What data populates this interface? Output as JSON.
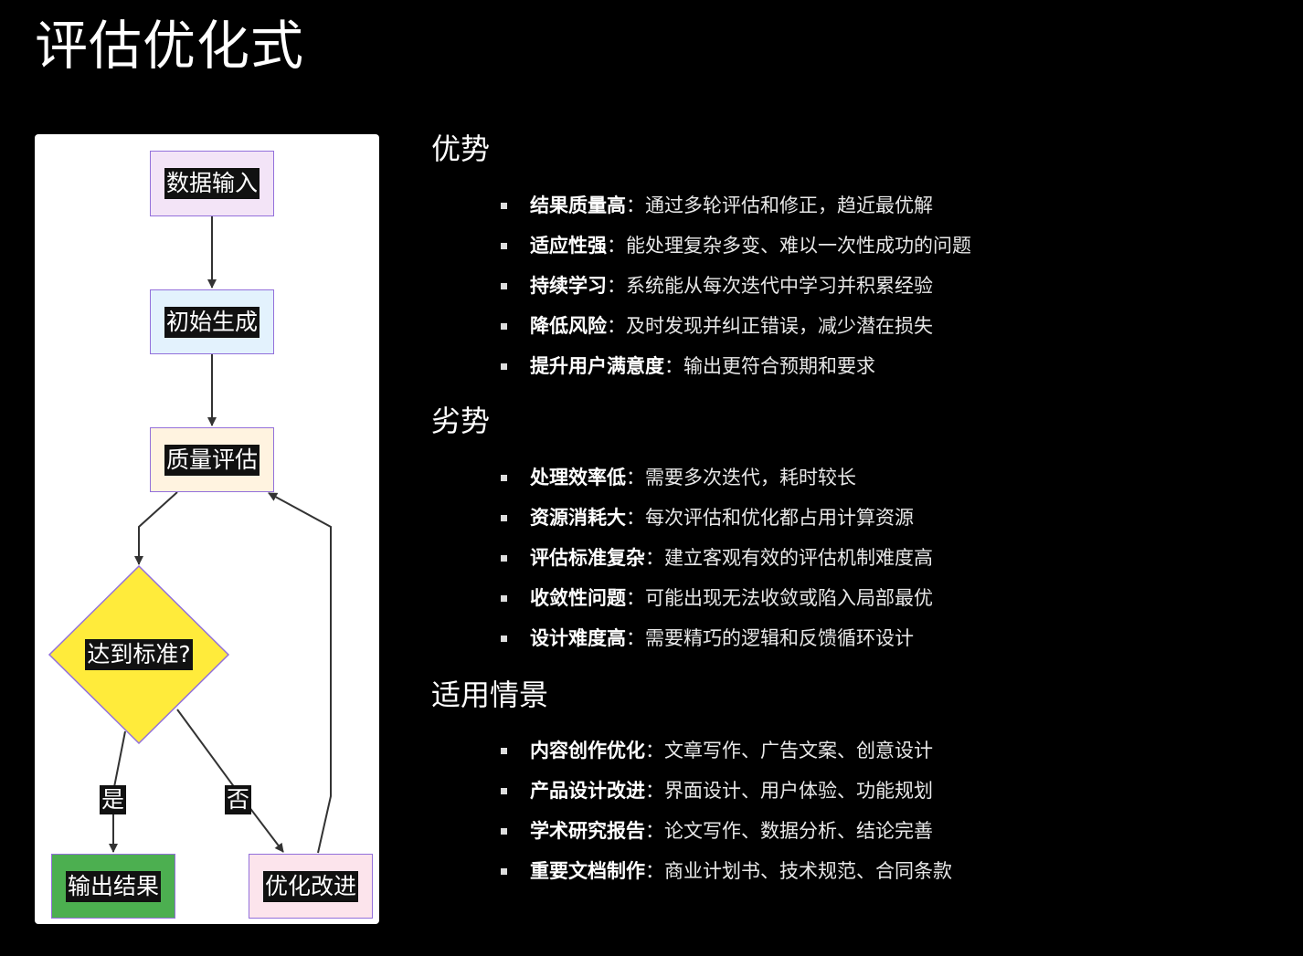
{
  "title": "评估优化式",
  "flowchart": {
    "nodes": {
      "input": "数据输入",
      "init": "初始生成",
      "eval": "质量评估",
      "decision": "达到标准?",
      "output": "输出结果",
      "improve": "优化改进"
    },
    "edges": {
      "yes": "是",
      "no": "否"
    },
    "colors": {
      "input_fill": "#f3e4f7",
      "init_fill": "#e3f2fd",
      "eval_fill": "#fff3e0",
      "decision_fill": "#ffeb3b",
      "output_fill": "#4caf50",
      "improve_fill": "#fce4ec",
      "border": "#9370db"
    }
  },
  "sections": [
    {
      "title": "优势",
      "items": [
        {
          "key": "结果质量高",
          "sep": "：",
          "text": "通过多轮评估和修正，趋近最优解"
        },
        {
          "key": "适应性强",
          "sep": "：",
          "text": "能处理复杂多变、难以一次性成功的问题"
        },
        {
          "key": "持续学习",
          "sep": "：",
          "text": "系统能从每次迭代中学习并积累经验"
        },
        {
          "key": "降低风险",
          "sep": "：",
          "text": "及时发现并纠正错误，减少潜在损失"
        },
        {
          "key": "提升用户满意度",
          "sep": "：",
          "text": "输出更符合预期和要求"
        }
      ]
    },
    {
      "title": "劣势",
      "items": [
        {
          "key": "处理效率低",
          "sep": "：",
          "text": "需要多次迭代，耗时较长"
        },
        {
          "key": "资源消耗大",
          "sep": "：",
          "text": "每次评估和优化都占用计算资源"
        },
        {
          "key": "评估标准复杂",
          "sep": "：",
          "text": "建立客观有效的评估机制难度高"
        },
        {
          "key": "收敛性问题",
          "sep": "：",
          "text": "可能出现无法收敛或陷入局部最优"
        },
        {
          "key": "设计难度高",
          "sep": "：",
          "text": "需要精巧的逻辑和反馈循环设计"
        }
      ]
    },
    {
      "title": "适用情景",
      "items": [
        {
          "key": "内容创作优化",
          "sep": "：",
          "text": "文章写作、广告文案、创意设计"
        },
        {
          "key": "产品设计改进",
          "sep": "：",
          "text": "界面设计、用户体验、功能规划"
        },
        {
          "key": "学术研究报告",
          "sep": "：",
          "text": "论文写作、数据分析、结论完善"
        },
        {
          "key": "重要文档制作",
          "sep": "：",
          "text": "商业计划书、技术规范、合同条款"
        }
      ]
    }
  ]
}
